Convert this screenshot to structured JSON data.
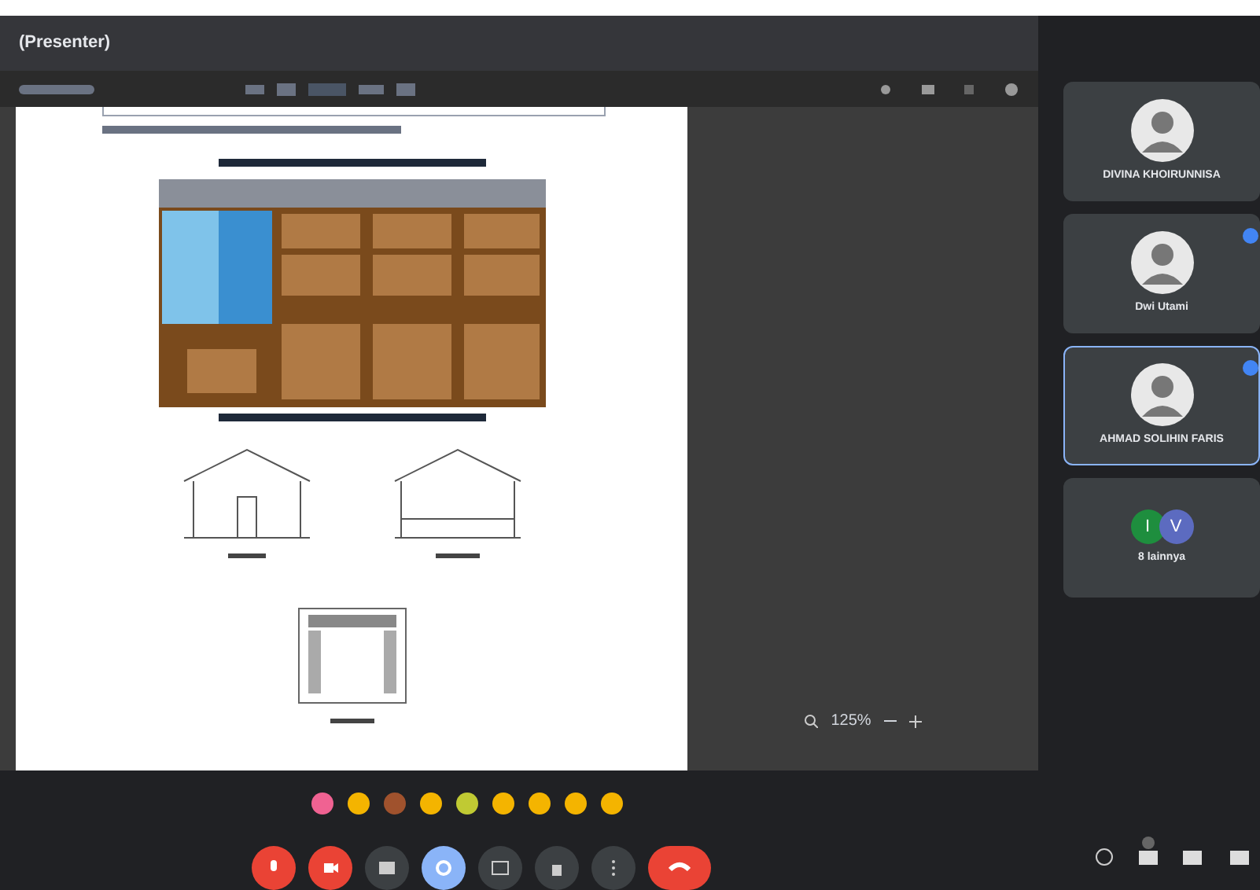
{
  "window": {
    "title": "(Presenter)"
  },
  "viewer": {
    "zoom": "125%"
  },
  "participants": [
    {
      "kind": "person",
      "name": "DIVINA KHOIRUNNISA",
      "selected": false,
      "pinned": false
    },
    {
      "kind": "person",
      "name": "Dwi Utami",
      "selected": false,
      "pinned": true
    },
    {
      "kind": "person",
      "name": "AHMAD SOLIHIN FARIS",
      "selected": true,
      "pinned": true
    },
    {
      "kind": "group",
      "name": "8 lainnya",
      "initials": [
        "I",
        "V"
      ],
      "selected": false,
      "pinned": false
    }
  ],
  "controls": [
    {
      "kind": "mic",
      "on": false
    },
    {
      "kind": "camera",
      "on": false
    },
    {
      "kind": "captions",
      "on": false
    },
    {
      "kind": "present",
      "on": true
    },
    {
      "kind": "activities",
      "on": false
    },
    {
      "kind": "hand",
      "on": false
    },
    {
      "kind": "more",
      "on": false
    },
    {
      "kind": "leave"
    }
  ]
}
